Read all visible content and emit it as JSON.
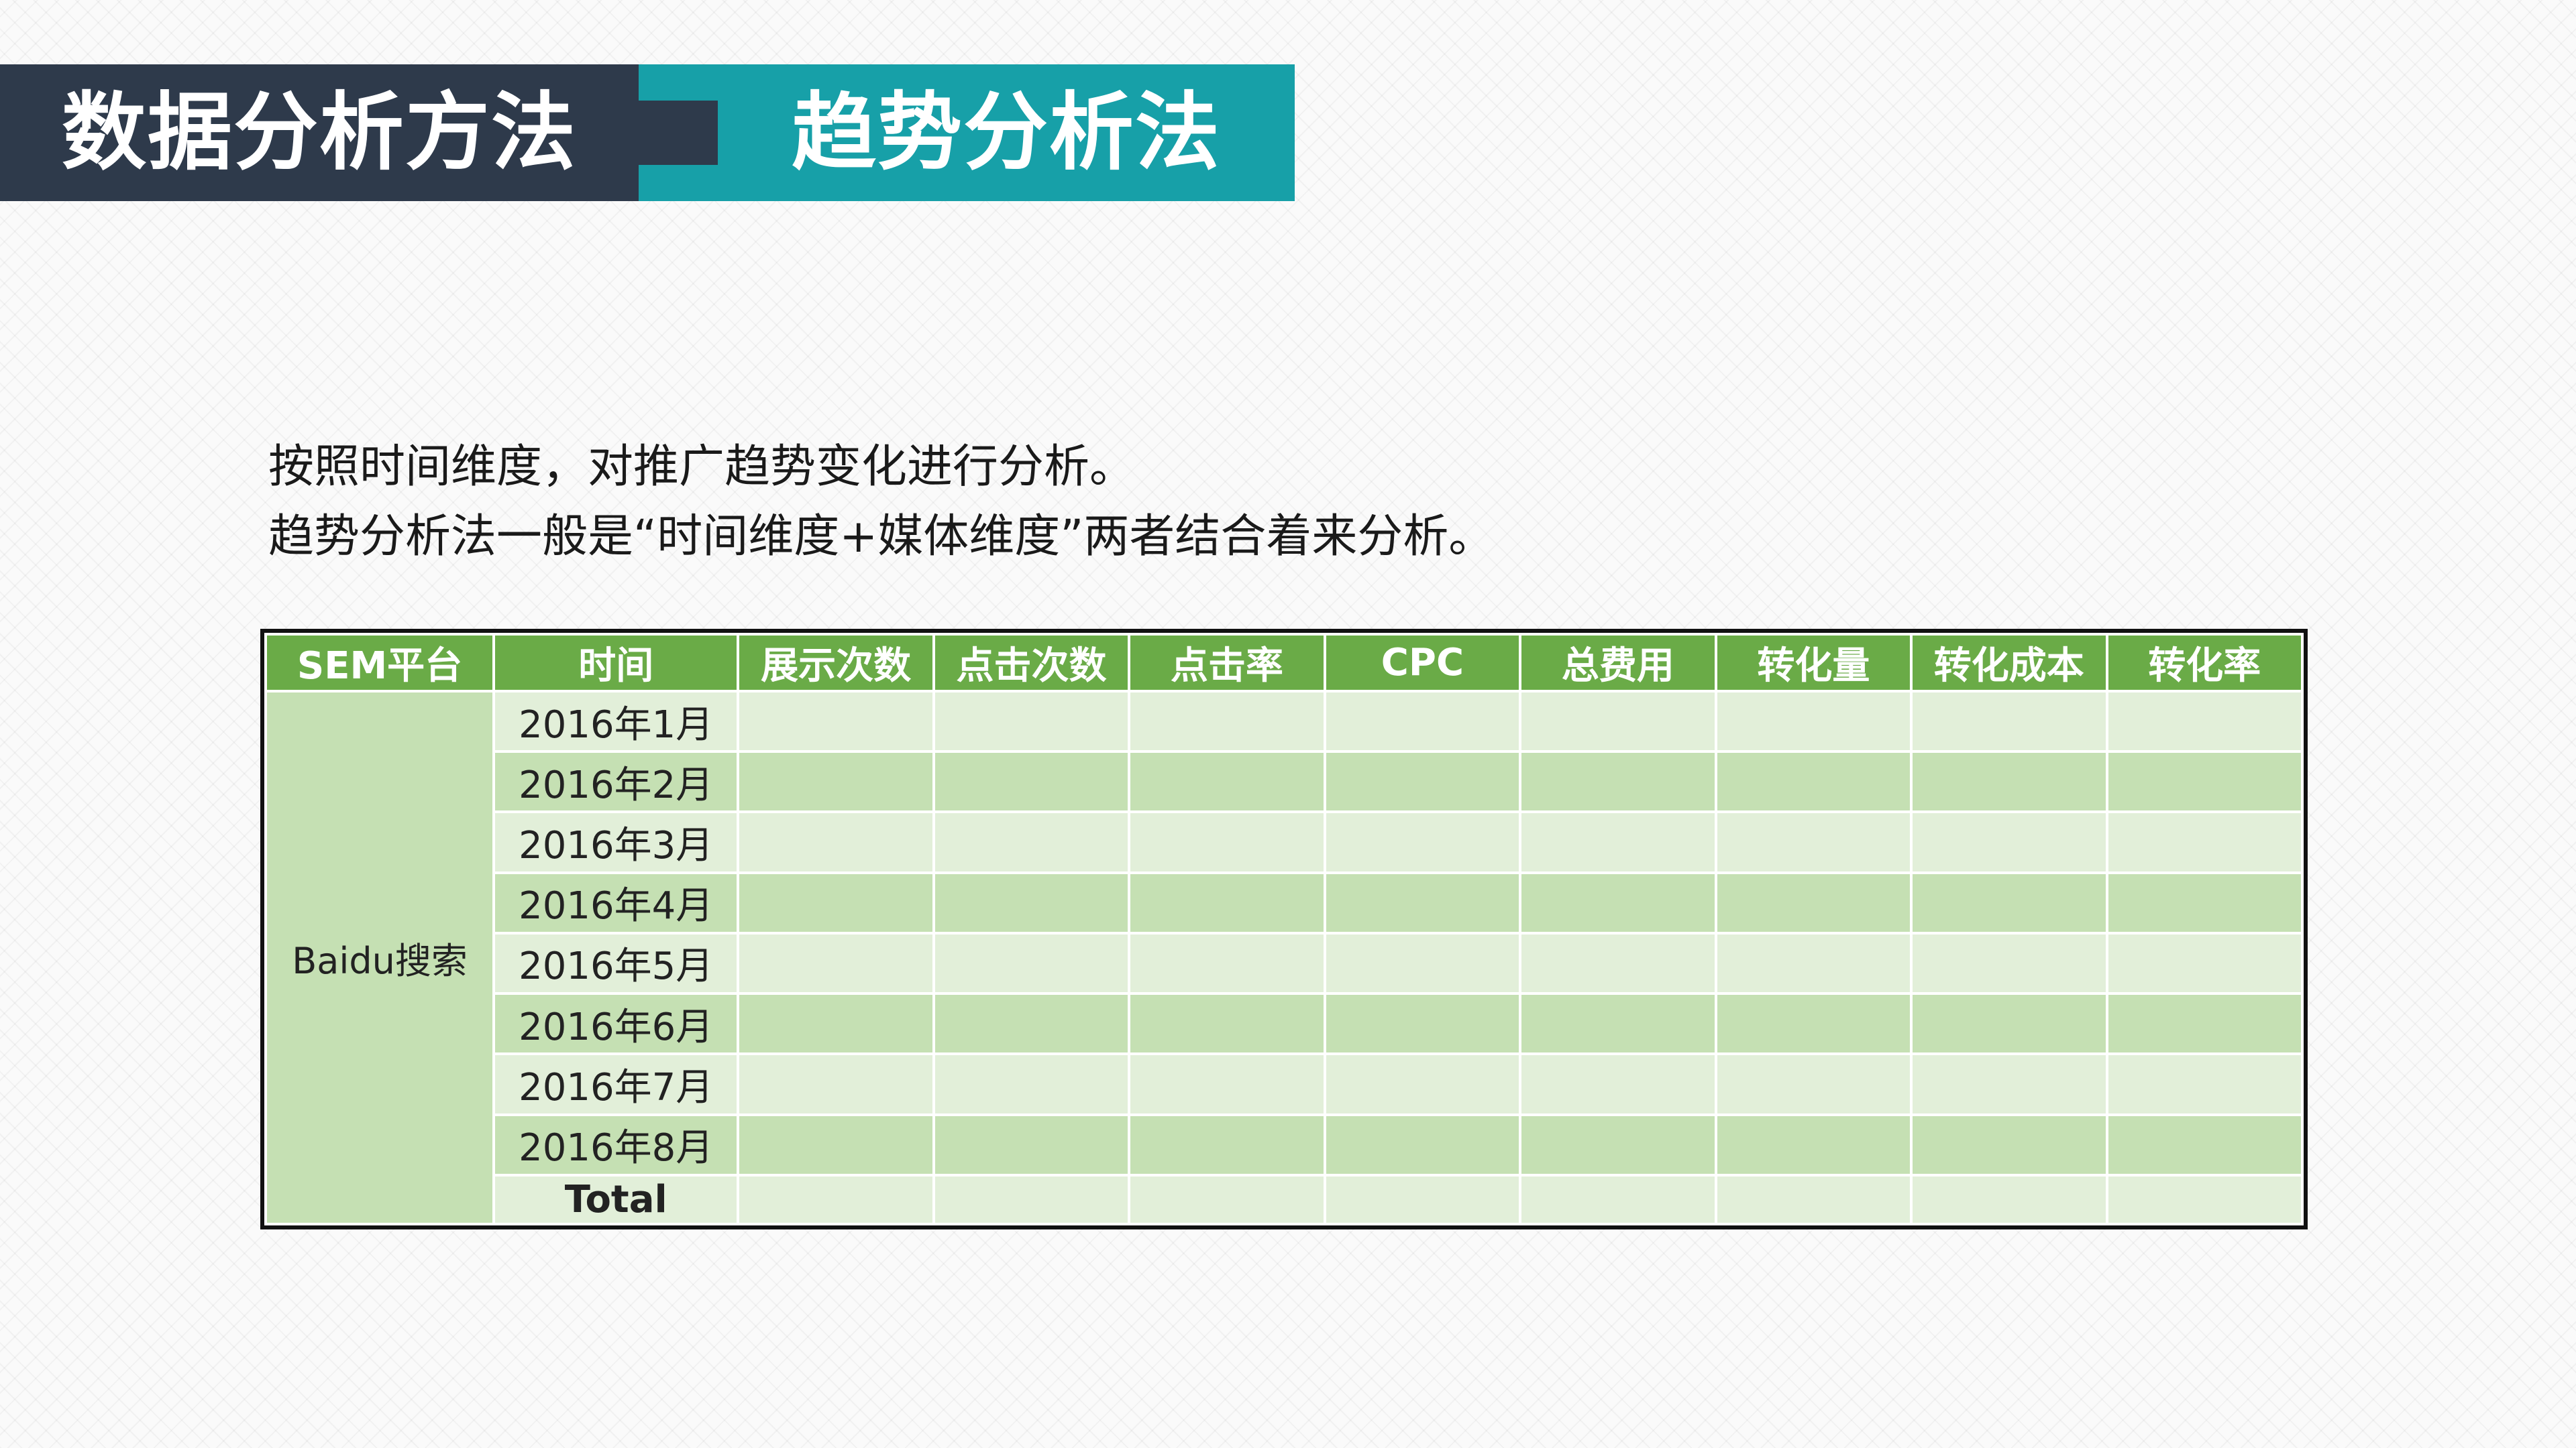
{
  "header": {
    "left_title": "数据分析方法",
    "right_title": "趋势分析法",
    "colors": {
      "dark": "#2e3a4b",
      "teal": "#17a0a8"
    }
  },
  "description": {
    "line1": "按照时间维度，对推广趋势变化进行分析。",
    "line2": "趋势分析法一般是“时间维度+媒体维度”两者结合着来分析。"
  },
  "table": {
    "colors": {
      "header": "#6aab47",
      "row_light": "#e2efd9",
      "row_dark": "#c5e0b3"
    },
    "columns": [
      "SEM平台",
      "时间",
      "展示次数",
      "点击次数",
      "点击率",
      "CPC",
      "总费用",
      "转化量",
      "转化成本",
      "转化率"
    ],
    "platform": "Baidu搜索",
    "months": [
      "2016年1月",
      "2016年2月",
      "2016年3月",
      "2016年4月",
      "2016年5月",
      "2016年6月",
      "2016年7月",
      "2016年8月"
    ],
    "total_label": "Total"
  }
}
